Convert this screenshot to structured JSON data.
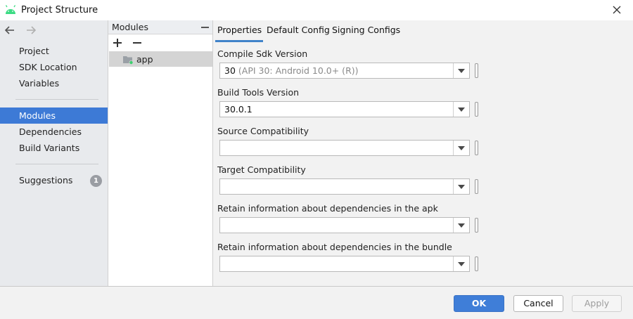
{
  "window": {
    "title": "Project Structure",
    "icon": "android-icon"
  },
  "sidebar": {
    "nav": {
      "back_icon": "arrow-left-icon",
      "forward_icon": "arrow-right-icon"
    },
    "groups": [
      {
        "items": [
          {
            "label": "Project"
          },
          {
            "label": "SDK Location"
          },
          {
            "label": "Variables"
          }
        ]
      },
      {
        "items": [
          {
            "label": "Modules",
            "active": true
          },
          {
            "label": "Dependencies"
          },
          {
            "label": "Build Variants"
          }
        ]
      },
      {
        "items": [
          {
            "label": "Suggestions",
            "badge": "1"
          }
        ]
      }
    ]
  },
  "modules": {
    "header": "Modules",
    "add_icon": "plus-icon",
    "remove_icon": "minus-icon",
    "items": [
      {
        "name": "app",
        "icon": "module-folder-icon"
      }
    ]
  },
  "properties": {
    "tabs": [
      {
        "label": "Properties",
        "selected": true
      },
      {
        "label": "Default Config"
      },
      {
        "label": "Signing Configs"
      }
    ],
    "fields": [
      {
        "label": "Compile Sdk Version",
        "value": "30",
        "hint": "(API 30: Android 10.0+ (R))"
      },
      {
        "label": "Build Tools Version",
        "value": "30.0.1",
        "hint": ""
      },
      {
        "label": "Source Compatibility",
        "value": "",
        "hint": ""
      },
      {
        "label": "Target Compatibility",
        "value": "",
        "hint": ""
      },
      {
        "label": "Retain information about dependencies in the apk",
        "value": "",
        "hint": ""
      },
      {
        "label": "Retain information about dependencies in the bundle",
        "value": "",
        "hint": ""
      }
    ]
  },
  "footer": {
    "ok_label": "OK",
    "cancel_label": "Cancel",
    "apply_label": "Apply"
  },
  "colors": {
    "accent": "#3d7ad6",
    "android_green": "#3ddc84",
    "apply_disabled_text": "#9c9c9c"
  }
}
